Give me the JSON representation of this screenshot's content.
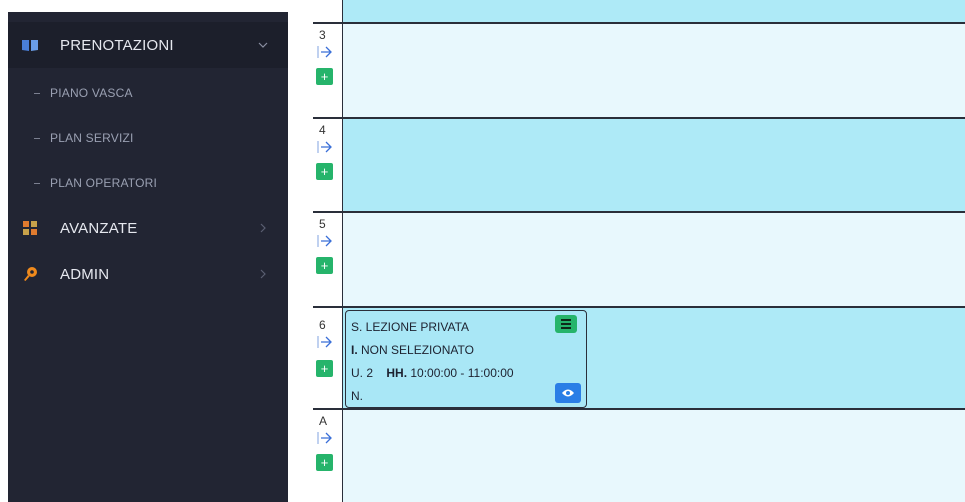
{
  "sidebar": {
    "items": [
      {
        "label": "PRENOTAZIONI",
        "icon": "book-icon",
        "expanded": true
      },
      {
        "label": "AVANZATE",
        "icon": "grid-icon"
      },
      {
        "label": "ADMIN",
        "icon": "key-icon"
      }
    ],
    "subitems": [
      {
        "label": "PIANO VASCA"
      },
      {
        "label": "PLAN SERVIZI"
      },
      {
        "label": "PLAN OPERATORI"
      }
    ]
  },
  "rows": [
    {
      "label": "3"
    },
    {
      "label": "4"
    },
    {
      "label": "5"
    },
    {
      "label": "6"
    },
    {
      "label": "A"
    }
  ],
  "booking": {
    "service": "S. LEZIONE PRIVATA",
    "instructor_prefix": "I.",
    "instructor": "NON SELEZIONATO",
    "units": "U. 2",
    "hours_prefix": "HH.",
    "hours": "10:00:00 - 11:00:00",
    "notes": "N."
  },
  "colors": {
    "sidebar_bg": "#222533",
    "row_light": "#e8f8fd",
    "row_dark": "#aeeaf7",
    "add_green": "#26b46b",
    "view_blue": "#2a7ee6"
  }
}
